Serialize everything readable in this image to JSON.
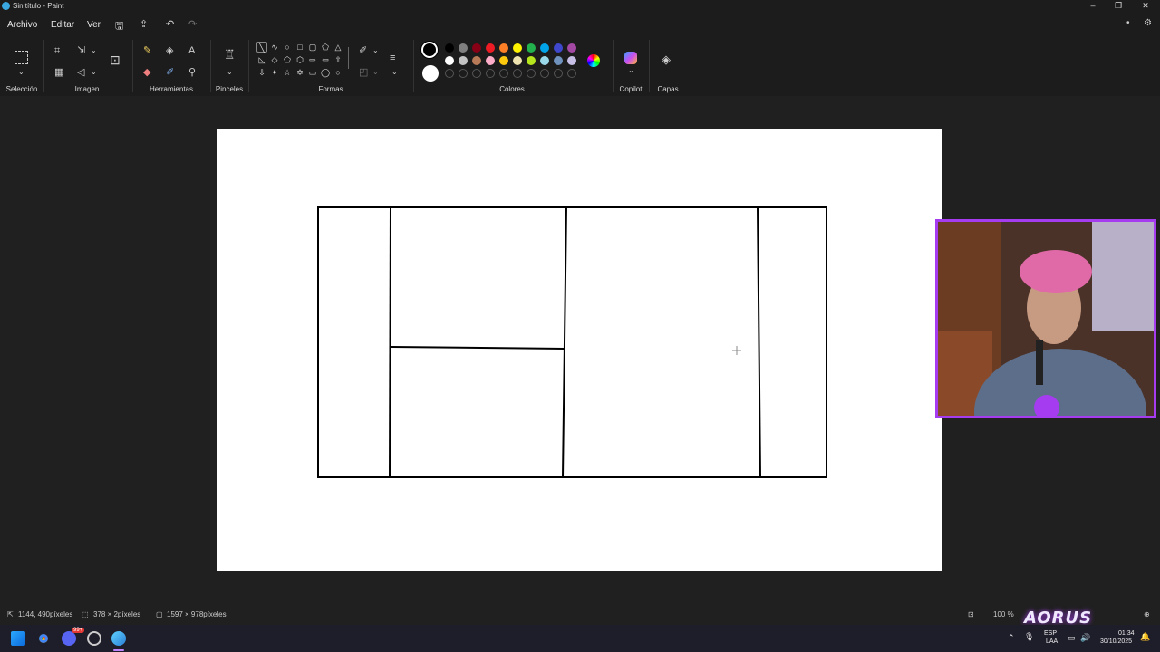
{
  "window": {
    "title": "Sin título - Paint",
    "minimize_icon": "minimize-icon",
    "maximize_icon": "restore-icon",
    "close_icon": "close-icon"
  },
  "menu": {
    "items": [
      "Archivo",
      "Editar",
      "Ver"
    ],
    "quick_actions": [
      "save-icon",
      "share-icon",
      "undo-icon",
      "redo-icon"
    ]
  },
  "ribbon": {
    "groups": [
      {
        "label": "Selección"
      },
      {
        "label": "Imagen"
      },
      {
        "label": "Herramientas"
      },
      {
        "label": "Pinceles"
      },
      {
        "label": "Formas"
      },
      {
        "label": "Colores"
      },
      {
        "label": "Copilot"
      },
      {
        "label": "Capas"
      }
    ],
    "colors": {
      "primary": "#000000",
      "secondary": "#ffffff",
      "row1": [
        "#000000",
        "#7f7f7f",
        "#880015",
        "#ed1c24",
        "#ff7f27",
        "#fff200",
        "#22b14c",
        "#00a2e8",
        "#3f48cc",
        "#a349a4"
      ],
      "row2": [
        "#ffffff",
        "#c3c3c3",
        "#b97a57",
        "#ffaec9",
        "#ffc90e",
        "#efe4b0",
        "#b5e61d",
        "#99d9ea",
        "#7092be",
        "#c8bfe7"
      ]
    }
  },
  "status": {
    "cursor_position": "1144, 490píxeles",
    "selection_size": "378 × 2píxeles",
    "canvas_size": "1597 × 978píxeles",
    "zoom": "100 %"
  },
  "taskbar": {
    "lang_top": "ESP",
    "lang_bottom": "LAA",
    "time": "01:34",
    "date": "30/10/2025",
    "badge": "99+"
  },
  "overlay": {
    "brand_text": "AORUS"
  },
  "accent": "#a53cf0"
}
